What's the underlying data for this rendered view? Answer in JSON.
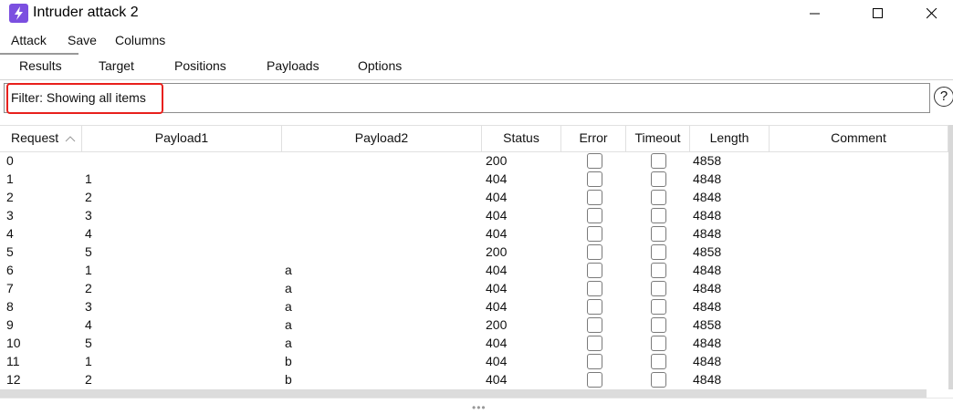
{
  "window": {
    "title": "Intruder attack 2"
  },
  "menu": [
    "Attack",
    "Save",
    "Columns"
  ],
  "tabs": [
    "Results",
    "Target",
    "Positions",
    "Payloads",
    "Options"
  ],
  "filter": {
    "text": "Filter: Showing all items"
  },
  "help": {
    "glyph": "?"
  },
  "columns": [
    "Request",
    "Payload1",
    "Payload2",
    "Status",
    "Error",
    "Timeout",
    "Length",
    "Comment"
  ],
  "sort_indicator": "^",
  "rows": [
    {
      "request": "0",
      "payload1": "",
      "payload2": "",
      "status": "200",
      "length": "4858"
    },
    {
      "request": "1",
      "payload1": "1",
      "payload2": "",
      "status": "404",
      "length": "4848"
    },
    {
      "request": "2",
      "payload1": "2",
      "payload2": "",
      "status": "404",
      "length": "4848"
    },
    {
      "request": "3",
      "payload1": "3",
      "payload2": "",
      "status": "404",
      "length": "4848"
    },
    {
      "request": "4",
      "payload1": "4",
      "payload2": "",
      "status": "404",
      "length": "4848"
    },
    {
      "request": "5",
      "payload1": "5",
      "payload2": "",
      "status": "200",
      "length": "4858"
    },
    {
      "request": "6",
      "payload1": "1",
      "payload2": "a",
      "status": "404",
      "length": "4848"
    },
    {
      "request": "7",
      "payload1": "2",
      "payload2": "a",
      "status": "404",
      "length": "4848"
    },
    {
      "request": "8",
      "payload1": "3",
      "payload2": "a",
      "status": "404",
      "length": "4848"
    },
    {
      "request": "9",
      "payload1": "4",
      "payload2": "a",
      "status": "200",
      "length": "4858"
    },
    {
      "request": "10",
      "payload1": "5",
      "payload2": "a",
      "status": "404",
      "length": "4848"
    },
    {
      "request": "11",
      "payload1": "1",
      "payload2": "b",
      "status": "404",
      "length": "4848"
    },
    {
      "request": "12",
      "payload1": "2",
      "payload2": "b",
      "status": "404",
      "length": "4848"
    }
  ],
  "colors": {
    "accent": "#7b4fe0",
    "highlight": "#e8201c"
  }
}
